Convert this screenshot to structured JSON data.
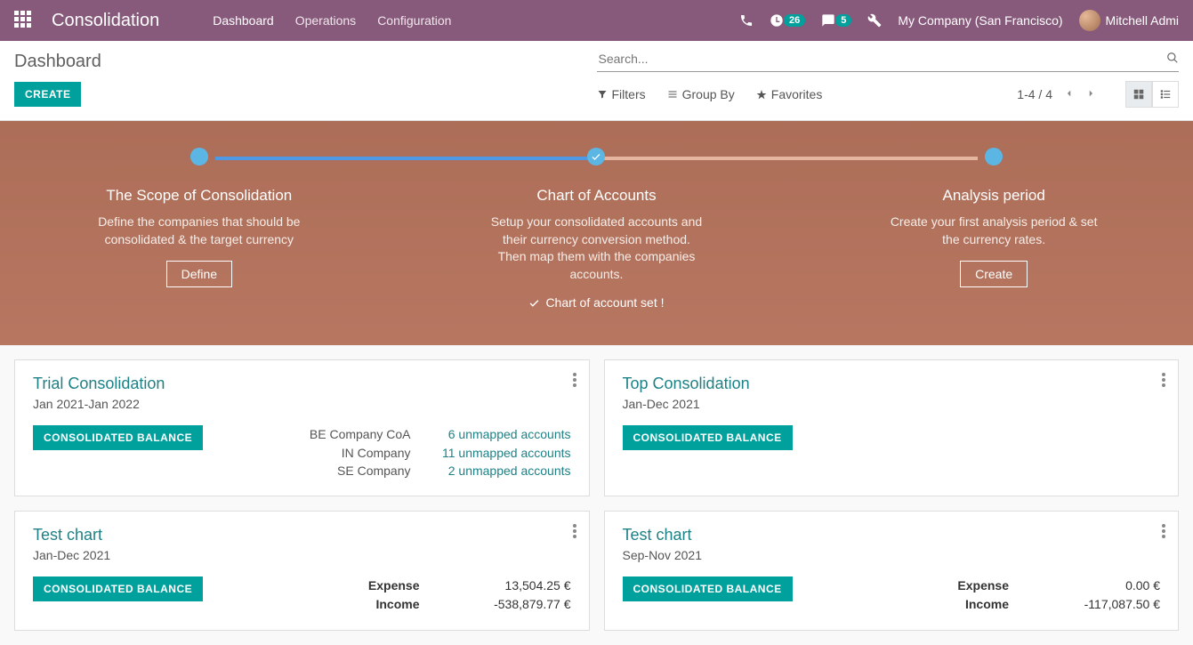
{
  "navbar": {
    "brand": "Consolidation",
    "menu": [
      "Dashboard",
      "Operations",
      "Configuration"
    ],
    "activity_count": "26",
    "message_count": "5",
    "company": "My Company (San Francisco)",
    "user": "Mitchell Admi"
  },
  "breadcrumb": "Dashboard",
  "create_button": "CREATE",
  "search": {
    "placeholder": "Search..."
  },
  "filters": {
    "filters": "Filters",
    "groupby": "Group By",
    "favorites": "Favorites"
  },
  "pager": "1-4 / 4",
  "onboarding": {
    "steps": [
      {
        "title": "The Scope of Consolidation",
        "desc": "Define the companies that should be consolidated & the target currency",
        "action": "Define"
      },
      {
        "title": "Chart of Accounts",
        "desc": "Setup your consolidated accounts and their currency conversion method. Then map them with the companies accounts.",
        "status": "Chart of account set !"
      },
      {
        "title": "Analysis period",
        "desc": "Create your first analysis period & set the currency rates.",
        "action": "Create"
      }
    ]
  },
  "consolidated_balance_label": "CONSOLIDATED BALANCE",
  "cards": [
    {
      "title": "Trial Consolidation",
      "subtitle": "Jan 2021-Jan 2022",
      "companies": [
        "BE Company CoA",
        "IN Company",
        "SE Company"
      ],
      "links": [
        "6 unmapped accounts",
        "11 unmapped accounts",
        "2 unmapped accounts"
      ]
    },
    {
      "title": "Top Consolidation",
      "subtitle": "Jan-Dec 2021"
    },
    {
      "title": "Test chart",
      "subtitle": "Jan-Dec 2021",
      "totals": {
        "Expense": "13,504.25 €",
        "Income": "-538,879.77 €"
      }
    },
    {
      "title": "Test chart",
      "subtitle": "Sep-Nov 2021",
      "totals": {
        "Expense": "0.00 €",
        "Income": "-117,087.50 €"
      }
    }
  ],
  "expense_label": "Expense",
  "income_label": "Income"
}
